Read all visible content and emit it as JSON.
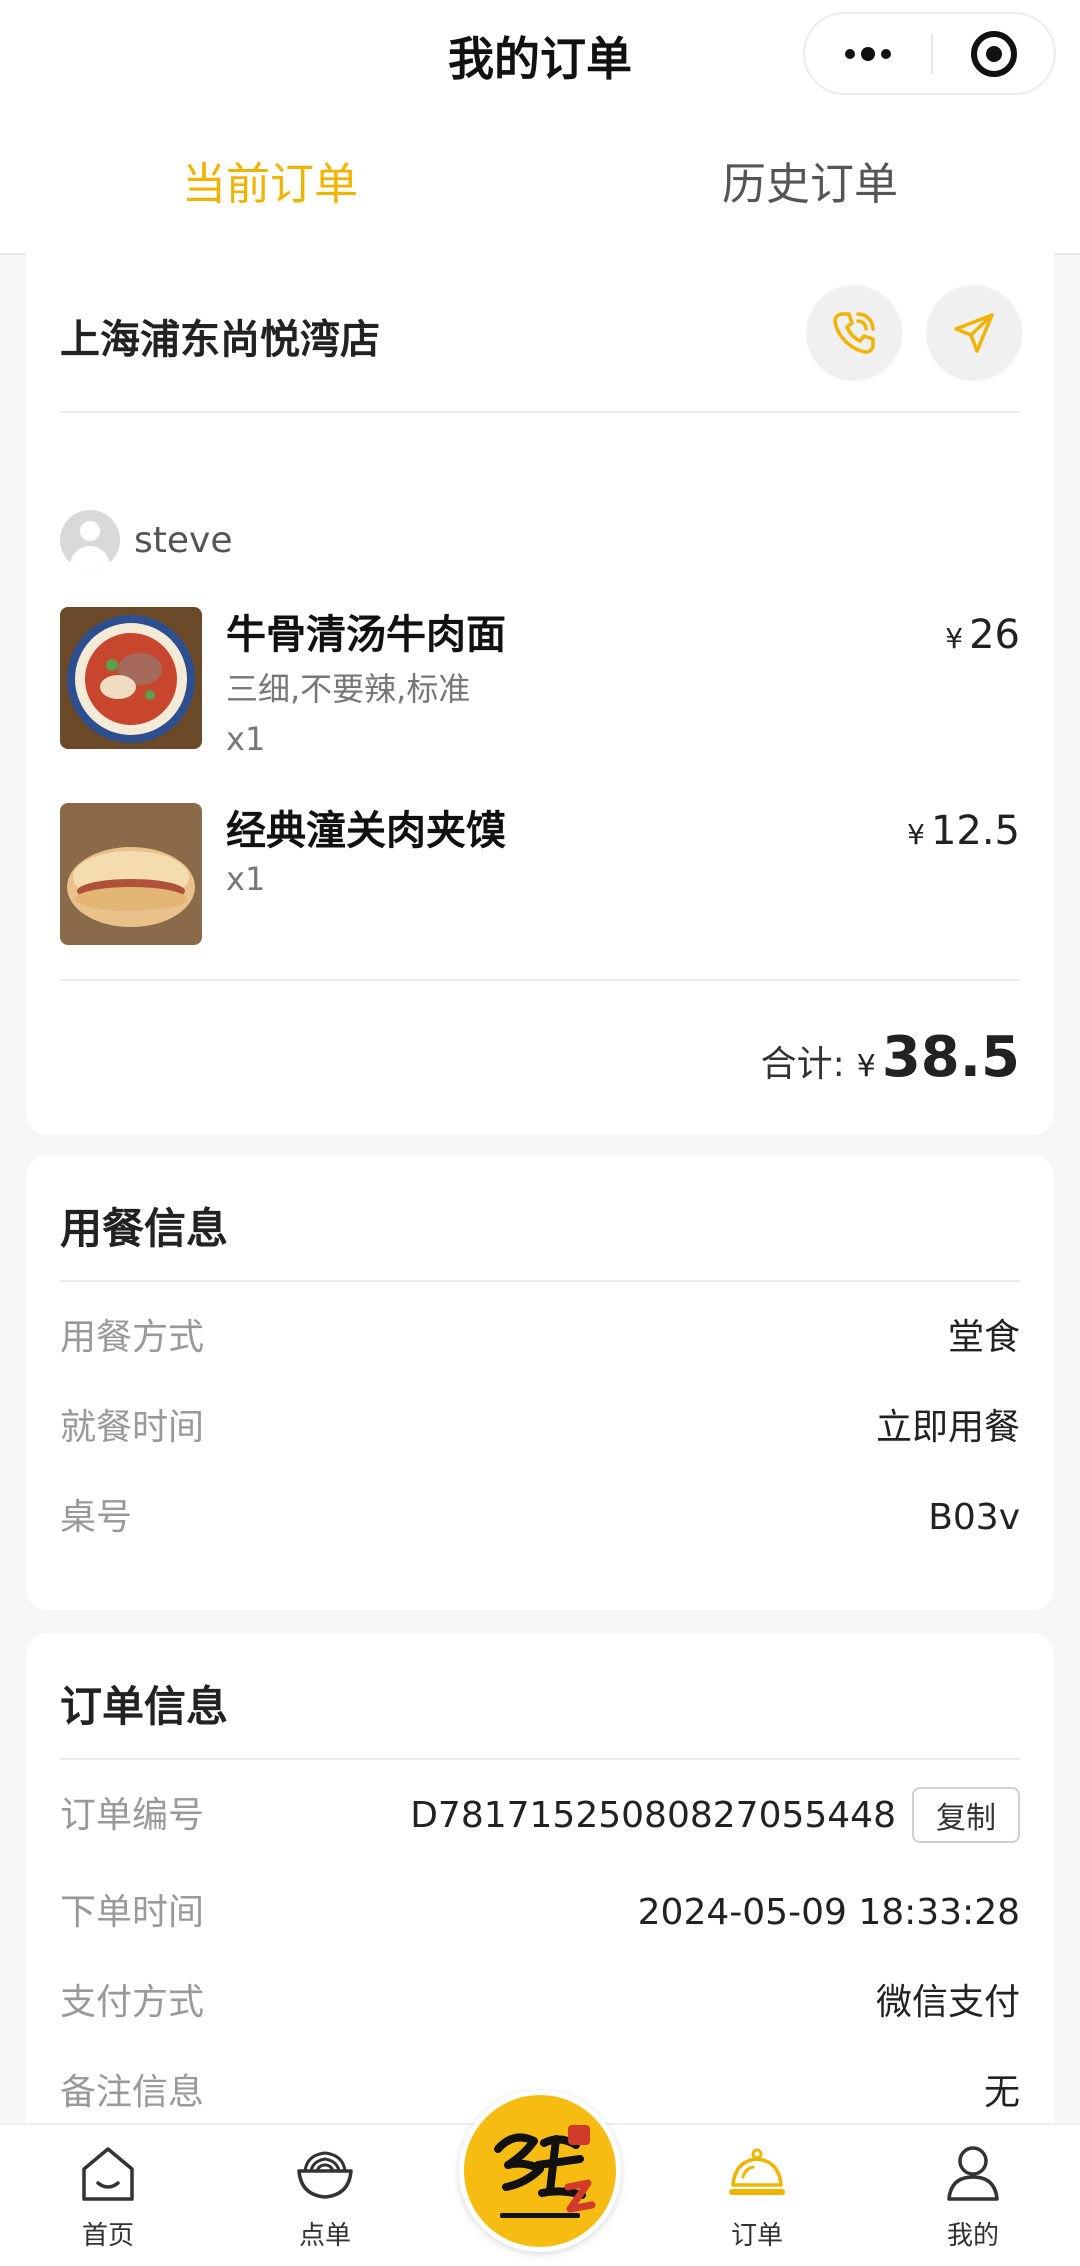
{
  "header": {
    "title": "我的订单"
  },
  "tabs": [
    {
      "label": "当前订单",
      "active": true
    },
    {
      "label": "历史订单",
      "active": false
    }
  ],
  "store": {
    "name": "上海浦东尚悦湾店"
  },
  "user": {
    "name": "steve"
  },
  "items": [
    {
      "name": "牛骨清汤牛肉面",
      "spec": "三细,不要辣,标准",
      "qty": "x1",
      "price": "26",
      "currency": "¥"
    },
    {
      "name": "经典潼关肉夹馍",
      "spec": "",
      "qty": "x1",
      "price": "12.5",
      "currency": "¥"
    }
  ],
  "total": {
    "label": "合计:",
    "currency": "¥",
    "value": "38.5"
  },
  "dining_info": {
    "title": "用餐信息",
    "rows": [
      {
        "label": "用餐方式",
        "value": "堂食"
      },
      {
        "label": "就餐时间",
        "value": "立即用餐"
      },
      {
        "label": "桌号",
        "value": "B03v"
      }
    ]
  },
  "order_info": {
    "title": "订单信息",
    "copy_label": "复制",
    "rows": [
      {
        "label": "订单编号",
        "value": "D7817152508082705544​8"
      },
      {
        "label": "下单时间",
        "value": "2024-05-09 18:33:28"
      },
      {
        "label": "支付方式",
        "value": "微信支付"
      },
      {
        "label": "备注信息",
        "value": "无"
      }
    ]
  },
  "tabbar": [
    {
      "label": "首页",
      "icon": "home-icon"
    },
    {
      "label": "点单",
      "icon": "noodle-bowl-icon"
    },
    {
      "label": "订单",
      "icon": "cloche-icon",
      "active": true
    },
    {
      "label": "我的",
      "icon": "person-icon"
    }
  ],
  "colors": {
    "accent": "#f0b400",
    "background": "#f6f6f6"
  }
}
